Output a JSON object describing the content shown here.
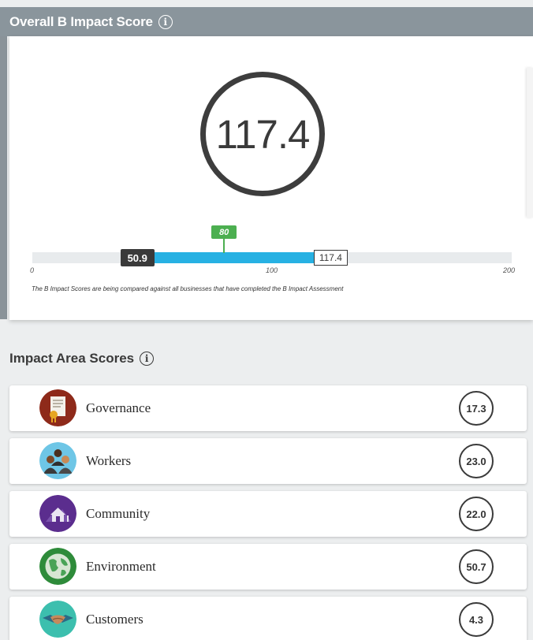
{
  "header": {
    "title": "Overall B Impact Score"
  },
  "overall": {
    "score": "117.4",
    "range_min": 0,
    "range_max": 200,
    "median_value": 50.9,
    "median_label": "50.9",
    "score_value": 117.4,
    "score_label": "117.4",
    "qualification_value": 80,
    "qualification_label": "80",
    "ticks": [
      "0",
      "100",
      "200"
    ],
    "note": "The B Impact Scores are being compared against all businesses that have completed the B Impact Assessment"
  },
  "impact_areas": {
    "title": "Impact Area Scores",
    "items": [
      {
        "label": "Governance",
        "score": "17.3",
        "icon": "governance-icon",
        "color": "#8e2a1a"
      },
      {
        "label": "Workers",
        "score": "23.0",
        "icon": "workers-icon",
        "color": "#6ec6e6"
      },
      {
        "label": "Community",
        "score": "22.0",
        "icon": "community-icon",
        "color": "#5b2d8e"
      },
      {
        "label": "Environment",
        "score": "50.7",
        "icon": "environment-icon",
        "color": "#2e8b3a"
      },
      {
        "label": "Customers",
        "score": "4.3",
        "icon": "customers-icon",
        "color": "#3cbfae"
      }
    ]
  },
  "colors": {
    "header": "#8a959c",
    "range": "#27b1e3",
    "qualification": "#4caf50",
    "dark": "#3a3a3a"
  }
}
